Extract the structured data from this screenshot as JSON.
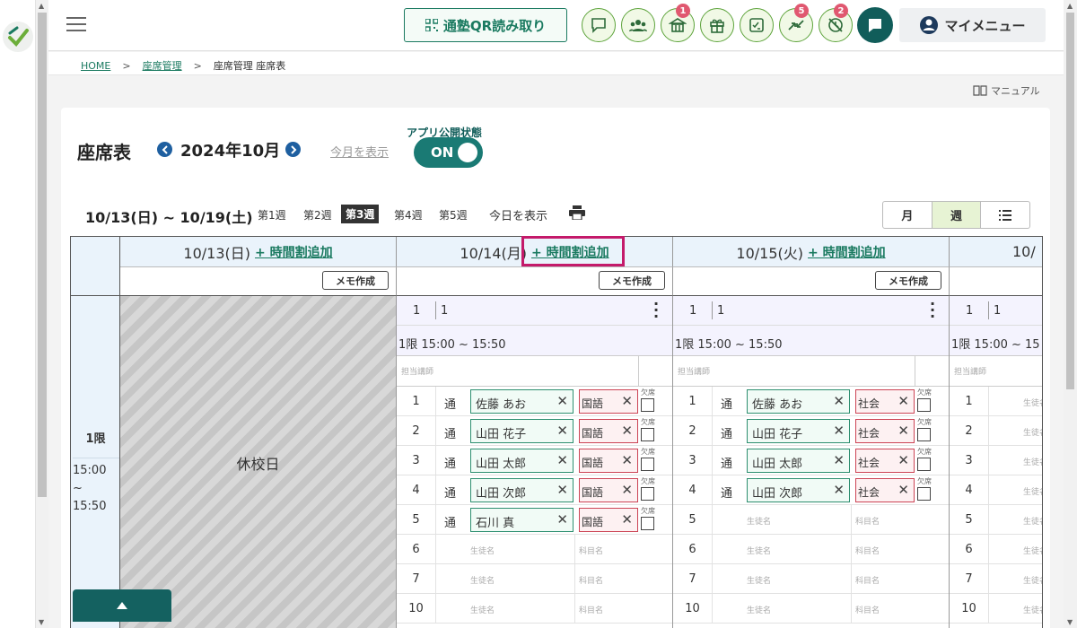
{
  "header": {
    "qr_label": "通塾QR読み取り",
    "badges": {
      "school": "1",
      "swap": "5",
      "blocked": "2"
    },
    "my_menu": "マイメニュー"
  },
  "breadcrumb": {
    "home": "HOME",
    "seat_mgmt": "座席管理",
    "current": "座席管理 座席表",
    "sep": ">"
  },
  "manual_label": "マニュアル",
  "page": {
    "title": "座席表",
    "month": "2024年10月",
    "show_this_month": "今月を表示",
    "publish_label": "アプリ公開状態",
    "publish_state": "ON"
  },
  "week": {
    "range": "10/13(日) ~ 10/19(土)",
    "weeks": [
      "第1週",
      "第2週",
      "第3週",
      "第4週",
      "第5週"
    ],
    "active_index": 2,
    "today": "今日を表示"
  },
  "view_toggle": [
    "月",
    "週"
  ],
  "view_active": "週",
  "grid": {
    "add_label": "+ 時間割追加",
    "memo_label": "メモ作成",
    "period": {
      "label": "1限",
      "time_line1": "15:00 ~",
      "time_line2": "15:50"
    },
    "holiday": "休校日",
    "days": [
      {
        "date": "10/13(日)"
      },
      {
        "date": "10/14(月)"
      },
      {
        "date": "10/15(火)"
      },
      {
        "date": "10/"
      }
    ],
    "slot_no": "1",
    "slot_name": "1",
    "slot_time": "1限 15:00 ~ 15:50",
    "slot_time_short": "1限 15:00 ~ 15",
    "teacher_label": "担当講師",
    "absent_label": "欠席",
    "student_placeholder": "生徒名",
    "subject_placeholder": "科目名",
    "mon_rows": [
      {
        "no": "1",
        "type": "通",
        "student": "佐藤 あお",
        "subject": "国語"
      },
      {
        "no": "2",
        "type": "通",
        "student": "山田 花子",
        "subject": "国語"
      },
      {
        "no": "3",
        "type": "通",
        "student": "山田 太郎",
        "subject": "国語"
      },
      {
        "no": "4",
        "type": "通",
        "student": "山田 次郎",
        "subject": "国語"
      },
      {
        "no": "5",
        "type": "通",
        "student": "石川 真",
        "subject": "国語"
      },
      {
        "no": "6"
      },
      {
        "no": "7"
      },
      {
        "no": "10"
      }
    ],
    "tue_rows": [
      {
        "no": "1",
        "type": "通",
        "student": "佐藤 あお",
        "subject": "社会"
      },
      {
        "no": "2",
        "type": "通",
        "student": "山田 花子",
        "subject": "社会"
      },
      {
        "no": "3",
        "type": "通",
        "student": "山田 太郎",
        "subject": "社会"
      },
      {
        "no": "4",
        "type": "通",
        "student": "山田 次郎",
        "subject": "社会"
      },
      {
        "no": "5"
      },
      {
        "no": "6"
      },
      {
        "no": "7"
      },
      {
        "no": "10"
      }
    ],
    "wed_rows": [
      {
        "no": "1"
      },
      {
        "no": "2"
      },
      {
        "no": "3"
      },
      {
        "no": "4"
      },
      {
        "no": "5"
      },
      {
        "no": "6"
      },
      {
        "no": "7"
      },
      {
        "no": "10"
      }
    ]
  },
  "colors": {
    "accent": "#1a7a60",
    "dark_teal": "#115d5a",
    "highlight": "#c41a6a",
    "badge": "#e05870"
  }
}
